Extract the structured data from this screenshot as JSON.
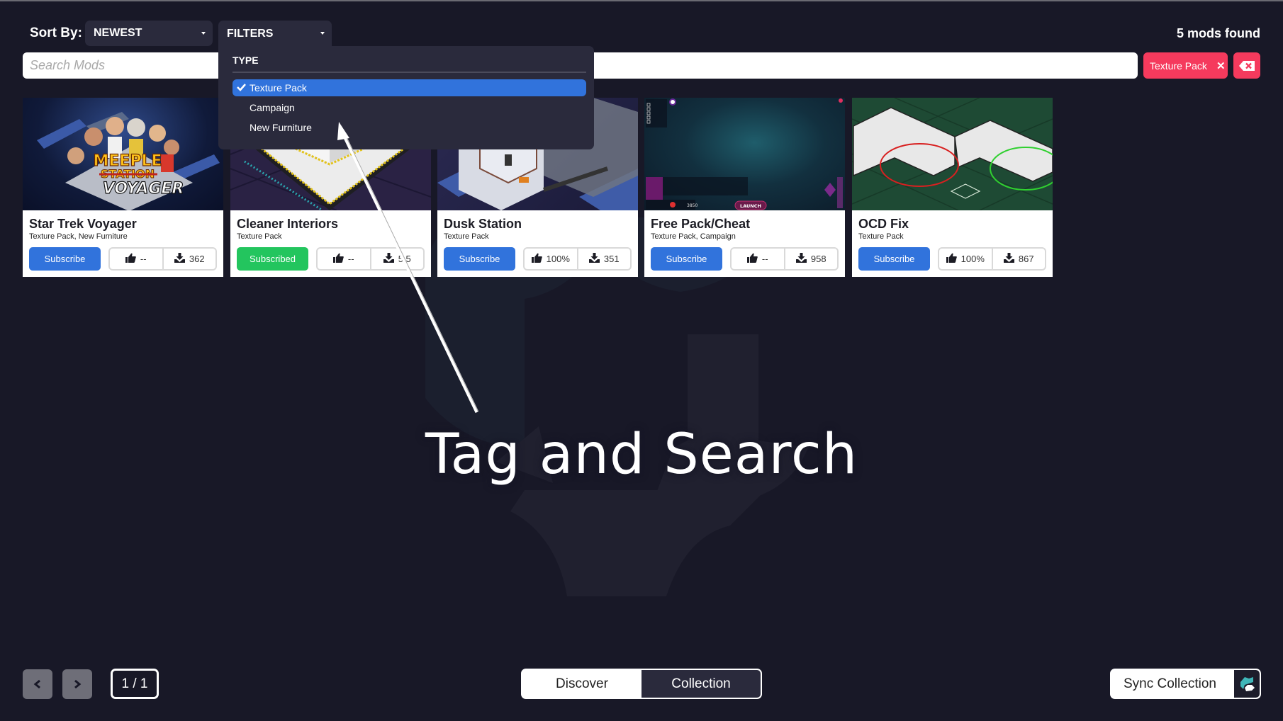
{
  "header": {
    "sort_label": "Sort By:",
    "sort_value": "NEWEST",
    "filters_label": "FILTERS",
    "mods_found": "5 mods found"
  },
  "search": {
    "placeholder": "Search Mods",
    "value": ""
  },
  "active_tags": [
    {
      "label": "Texture Pack",
      "remove_icon": "close-icon"
    }
  ],
  "clear_tags_icon": "backspace-icon",
  "filters_dropdown": {
    "section_title": "TYPE",
    "options": [
      {
        "label": "Texture Pack",
        "selected": true
      },
      {
        "label": "Campaign",
        "selected": false
      },
      {
        "label": "New Furniture",
        "selected": false
      }
    ]
  },
  "mods": [
    {
      "title": "Star Trek Voyager",
      "tags": "Texture Pack, New Furniture",
      "button": "Subscribe",
      "subscribed": false,
      "rating": "--",
      "downloads": "362",
      "thumb_hint": "Meeple Station Voyager artwork"
    },
    {
      "title": "Cleaner Interiors",
      "tags": "Texture Pack",
      "button": "Subscribed",
      "subscribed": true,
      "rating": "--",
      "downloads": "5 5",
      "thumb_hint": "white isometric floor tiles"
    },
    {
      "title": "Dusk Station",
      "tags": "Texture Pack",
      "button": "Subscribe",
      "subscribed": false,
      "rating": "100%",
      "downloads": "351",
      "thumb_hint": "isometric station modules"
    },
    {
      "title": "Free Pack/Cheat",
      "tags": "Texture Pack, Campaign",
      "button": "Subscribe",
      "subscribed": false,
      "rating": "--",
      "downloads": "958",
      "thumb_hint": "game UI screenshot with LAUNCH button"
    },
    {
      "title": "OCD Fix",
      "tags": "Texture Pack",
      "button": "Subscribe",
      "subscribed": false,
      "rating": "100%",
      "downloads": "867",
      "thumb_hint": "wall corners with red and green circles"
    }
  ],
  "thumb_texts": {
    "voyager_line1": "MEEPLE",
    "voyager_line2": "STATION",
    "voyager_line3": "VOYAGER",
    "launch": "LAUNCH",
    "credits": "3850"
  },
  "overlay": {
    "caption": "Tag and Search"
  },
  "pagination": {
    "prev_icon": "chevron-left-icon",
    "next_icon": "chevron-right-icon",
    "page": "1 / 1"
  },
  "view_tabs": [
    {
      "label": "Discover",
      "active": false
    },
    {
      "label": "Collection",
      "active": true
    }
  ],
  "sync": {
    "label": "Sync Collection",
    "icon": "sync-logo-icon"
  },
  "colors": {
    "background": "#181827",
    "panel": "#2a2a3c",
    "accent_blue": "#3173dc",
    "subscribed_green": "#23c55e",
    "tag_red": "#f53a5d"
  }
}
